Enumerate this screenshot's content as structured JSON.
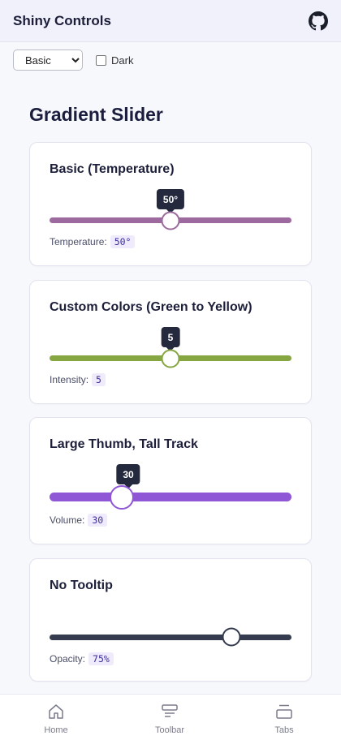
{
  "header": {
    "title": "Shiny Controls",
    "icon": "github-icon"
  },
  "controls": {
    "mode_selected": "Basic",
    "mode_options": [
      "Basic"
    ],
    "dark_label": "Dark",
    "dark_checked": false
  },
  "page": {
    "heading": "Gradient Slider"
  },
  "cards": [
    {
      "title": "Basic (Temperature)",
      "value": 50,
      "min": 0,
      "max": 100,
      "tooltip": "50°",
      "label": "Temperature:",
      "value_text": "50°",
      "track_color": "#9c6a9e",
      "thumb_border": "#9c6a9e"
    },
    {
      "title": "Custom Colors (Green to Yellow)",
      "value": 5,
      "min": 0,
      "max": 10,
      "tooltip": "5",
      "label": "Intensity:",
      "value_text": "5",
      "track_color": "#86a641",
      "thumb_border": "#86a641"
    },
    {
      "title": "Large Thumb, Tall Track",
      "value": 30,
      "min": 0,
      "max": 100,
      "tooltip": "30",
      "label": "Volume:",
      "value_text": "30",
      "track_color": "#8f56d6",
      "thumb_border": "#8f56d6"
    },
    {
      "title": "No Tooltip",
      "value": 75,
      "min": 0,
      "max": 100,
      "label": "Opacity:",
      "value_text": "75%",
      "track_color": "#363c4f",
      "thumb_border": "#363c4f"
    }
  ],
  "tabs": [
    {
      "label": "Home",
      "icon": "home-icon"
    },
    {
      "label": "Toolbar",
      "icon": "toolbar-icon"
    },
    {
      "label": "Tabs",
      "icon": "tabs-icon"
    }
  ]
}
